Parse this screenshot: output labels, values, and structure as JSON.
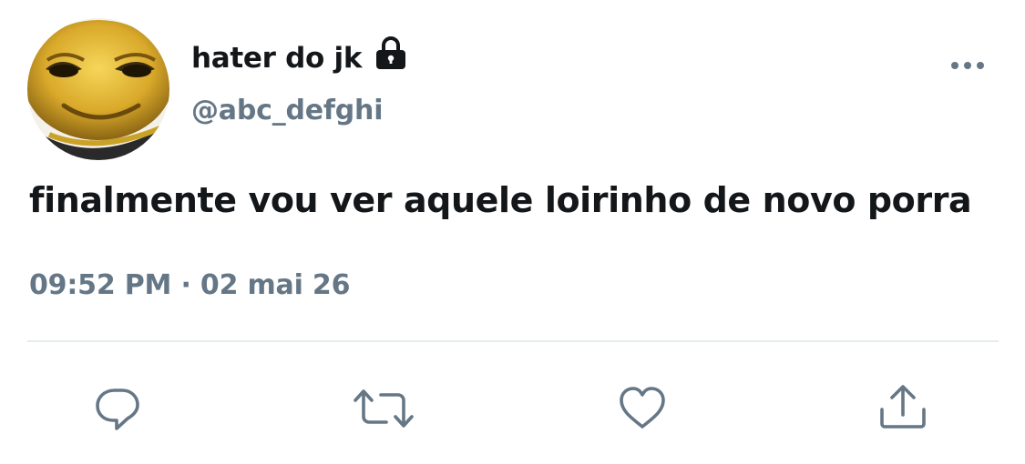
{
  "user": {
    "display_name": "hater do jk",
    "handle": "@abc_defghi",
    "protected": true,
    "avatar_icon": "yellow-creature-face-avatar"
  },
  "tweet": {
    "text": "finalmente vou ver aquele loirinho de novo porra",
    "time": "09:52 PM",
    "separator": "·",
    "date": "02 mai 26"
  },
  "actions": [
    {
      "name": "reply",
      "icon": "speech-bubble-icon"
    },
    {
      "name": "retweet",
      "icon": "retweet-arrows-icon"
    },
    {
      "name": "like",
      "icon": "heart-icon"
    },
    {
      "name": "share",
      "icon": "share-upload-icon"
    }
  ],
  "colors": {
    "text_primary": "#14171a",
    "text_secondary": "#657786",
    "divider": "#e6ecf0"
  }
}
